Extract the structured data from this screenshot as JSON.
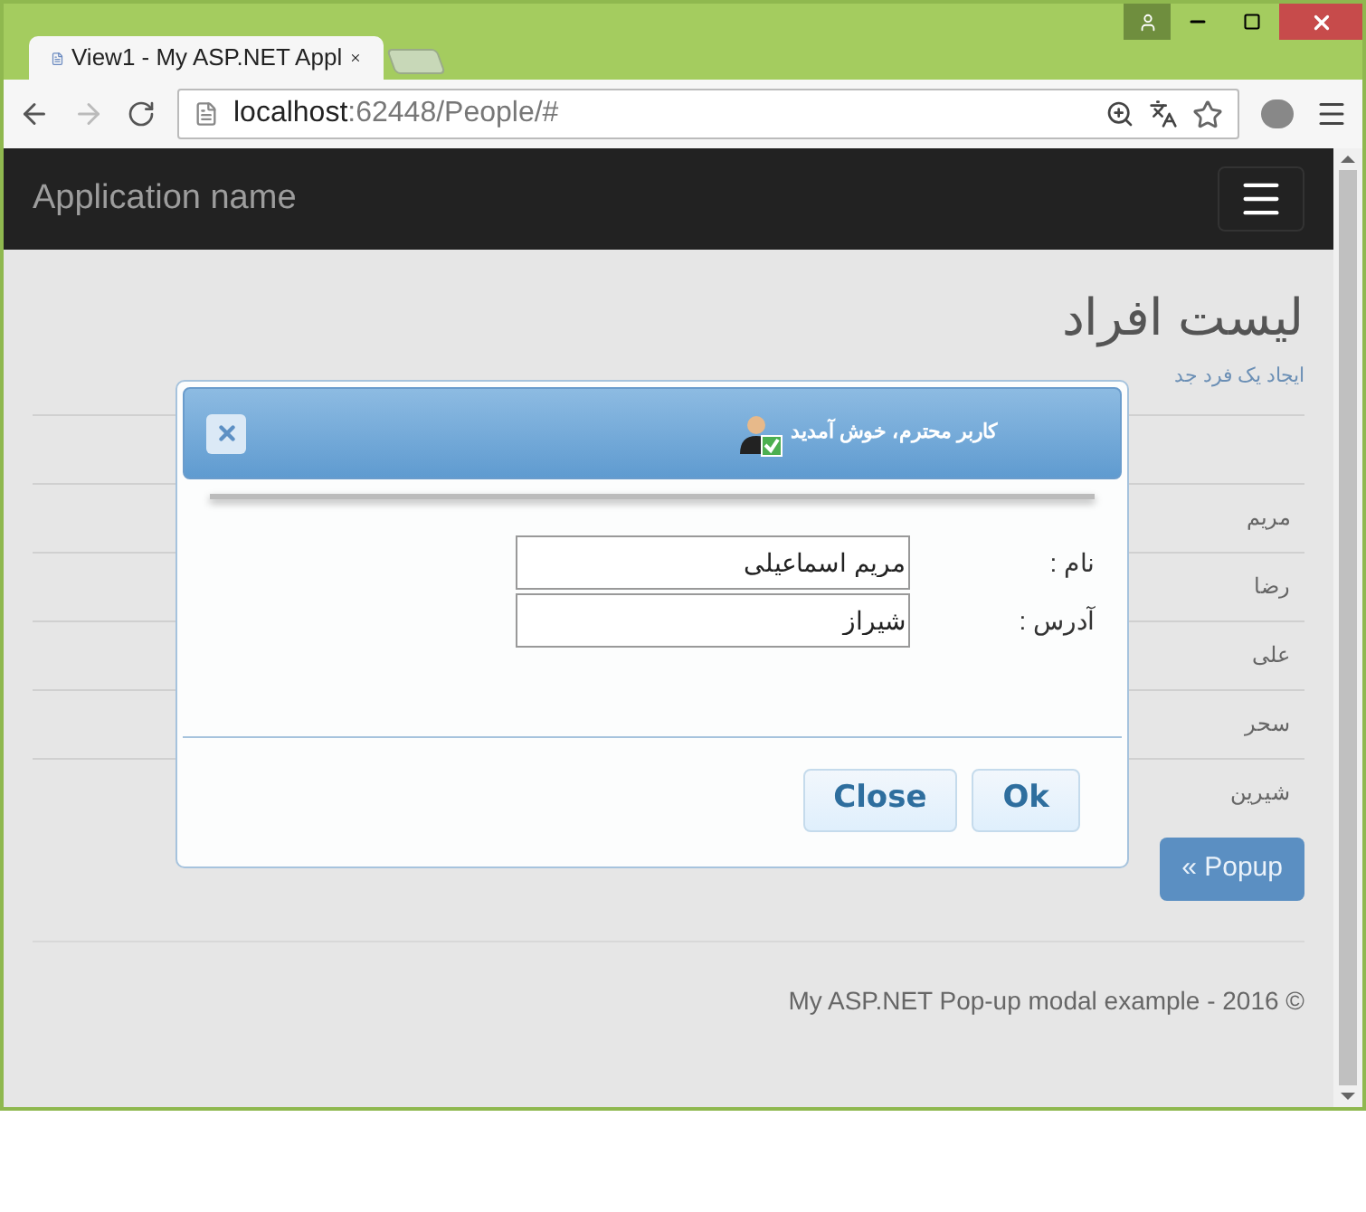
{
  "tabs": [
    {
      "title": "View1 - My ASP.NET Appl",
      "selected": true
    }
  ],
  "address": {
    "host": "localhost",
    "path": ":62448/People/#"
  },
  "navbar": {
    "brand": "Application name"
  },
  "page": {
    "heading": "لیست افراد",
    "create_link": "ایجاد یک فرد جد",
    "people": [
      "مریم",
      "رضا",
      "علی",
      "سحر",
      "شیرین"
    ],
    "popup_button": "« Popup",
    "footer": "My ASP.NET Pop-up modal example - 2016 ©"
  },
  "dialog": {
    "title": "کاربر محترم، خوش آمدید",
    "fields": [
      {
        "label": "نام :",
        "value": "مریم اسماعیلی"
      },
      {
        "label": "آدرس :",
        "value": "شیراز"
      }
    ],
    "buttons": [
      "Ok",
      "Close"
    ]
  }
}
